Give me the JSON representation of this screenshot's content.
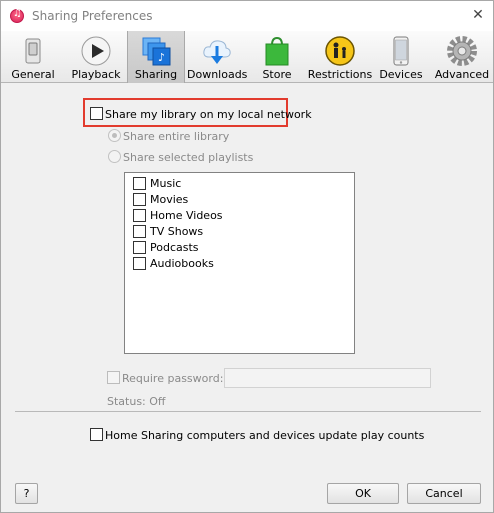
{
  "window": {
    "title": "Sharing Preferences"
  },
  "toolbar": {
    "items": [
      {
        "label": "General",
        "icon": "general-switch-icon"
      },
      {
        "label": "Playback",
        "icon": "play-icon"
      },
      {
        "label": "Sharing",
        "icon": "sharing-icon",
        "active": true
      },
      {
        "label": "Downloads",
        "icon": "cloud-download-icon"
      },
      {
        "label": "Store",
        "icon": "shopping-bag-icon"
      },
      {
        "label": "Restrictions",
        "icon": "parental-restrictions-icon"
      },
      {
        "label": "Devices",
        "icon": "phone-device-icon"
      },
      {
        "label": "Advanced",
        "icon": "gear-icon"
      }
    ]
  },
  "sharing": {
    "share_library_label": "Share my library on my local network",
    "share_entire_label": "Share entire library",
    "share_selected_label": "Share selected playlists",
    "playlists": [
      "Music",
      "Movies",
      "Home Videos",
      "TV Shows",
      "Podcasts",
      "Audiobooks"
    ],
    "require_password_label": "Require password:",
    "status": "Status: Off",
    "home_sharing_label": "Home Sharing computers and devices update play counts"
  },
  "buttons": {
    "help": "?",
    "ok": "OK",
    "cancel": "Cancel"
  },
  "colors": {
    "highlight": "#e23b2e",
    "accent_blue": "#1a73d9",
    "store_green": "#3cb83c"
  }
}
